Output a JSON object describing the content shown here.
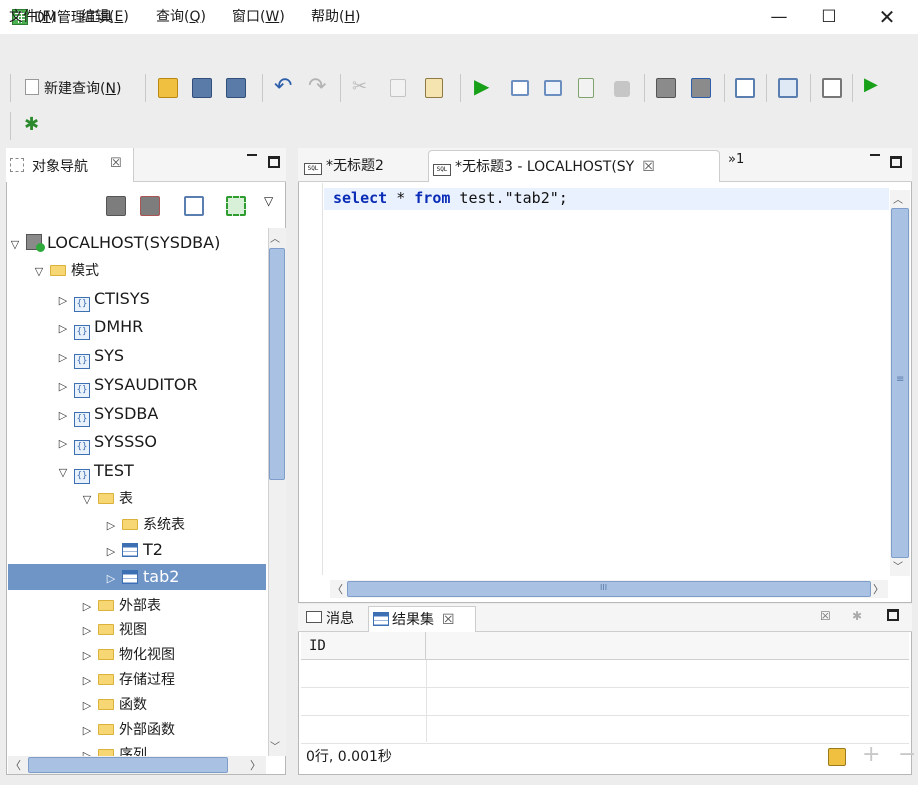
{
  "window": {
    "title": "DM管理工具",
    "min": "—",
    "max": "☐",
    "close": "✕"
  },
  "menu": [
    {
      "label": "文件(",
      "key": "F",
      "end": ")"
    },
    {
      "label": "编辑(",
      "key": "E",
      "end": ")"
    },
    {
      "label": "查询(",
      "key": "Q",
      "end": ")"
    },
    {
      "label": "窗口(",
      "key": "W",
      "end": ")"
    },
    {
      "label": "帮助(",
      "key": "H",
      "end": ")"
    }
  ],
  "toolbar": {
    "new_query": "新建查询(",
    "new_query_key": "N",
    "new_query_end": ")"
  },
  "left_panel": {
    "tab_label": "对象导航",
    "tab_close": "☒",
    "tree": {
      "root": "LOCALHOST(SYSDBA)",
      "schemas_folder": "模式",
      "schemas": [
        "CTISYS",
        "DMHR",
        "SYS",
        "SYSAUDITOR",
        "SYSDBA",
        "SYSSSO",
        "TEST"
      ],
      "tables_folder": "表",
      "system_tables": "系统表",
      "tables": [
        "T2",
        "tab2"
      ],
      "other_folders": [
        "外部表",
        "视图",
        "物化视图",
        "存储过程",
        "函数",
        "外部函数",
        "序列"
      ]
    }
  },
  "editor": {
    "tabs": [
      {
        "label": "*无标题2",
        "icon": "SQL"
      },
      {
        "label": "*无标题3 - LOCALHOST(SY",
        "icon": "SQL",
        "close": "☒"
      }
    ],
    "overflow": "»1",
    "code": {
      "kw1": "select",
      "mid1": " * ",
      "kw2": "from",
      "rest": " test.\"tab2\";"
    },
    "scroll_mid": "≡",
    "hscroll_mid": "III"
  },
  "results": {
    "tabs": [
      "消息",
      "结果集"
    ],
    "results_close": "☒",
    "columns": [
      "ID"
    ],
    "status": "0行, 0.001秒"
  },
  "colors": {
    "selection": "#6f95c7",
    "keyword": "#0a2cb6",
    "scrollbar": "#a9c2e3"
  }
}
